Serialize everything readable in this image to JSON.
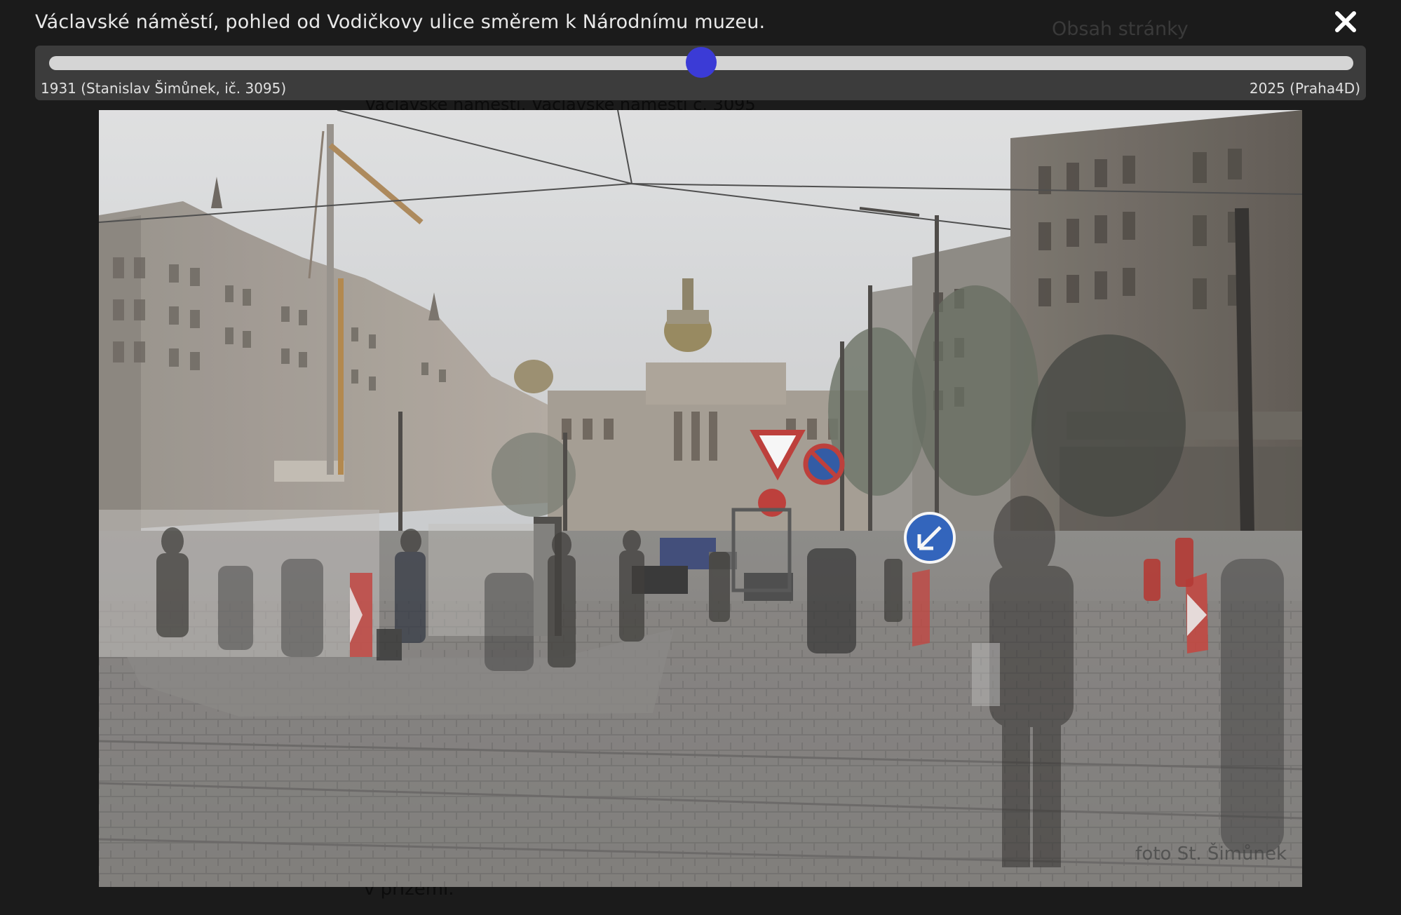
{
  "lightbox": {
    "caption": "Václavské náměstí, pohled od Vodičkovy ulice směrem k Národnímu muzeu.",
    "close_icon": "close-icon",
    "slider": {
      "value_percent": 50,
      "left_label": "1931 (Stanislav Šimůnek, ič. 3095)",
      "right_label": "2025 (Praha4D)",
      "thumb_color": "#3b3bd6"
    },
    "photo": {
      "watermark": "foto St. Šimůnek"
    }
  },
  "background_page": {
    "heading": "Obsah stránky",
    "text_fragment_bottom": "v přízemí.",
    "text_fragment_top": "Václavské náměstí, Václavské náměstí č. 3095"
  }
}
